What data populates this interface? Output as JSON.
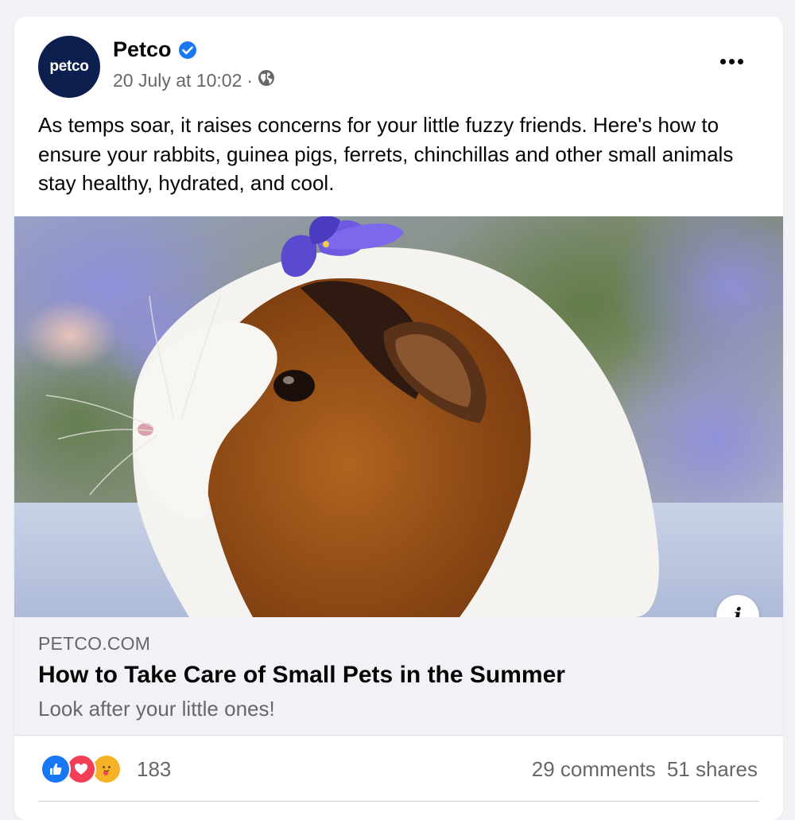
{
  "post": {
    "page_name": "Petco",
    "avatar_text": "petco",
    "timestamp": "20 July at 10:02",
    "separator": "·",
    "text": "As temps soar, it raises concerns for your little fuzzy friends. Here's how to ensure your rabbits, guinea pigs, ferrets, chinchillas and other small animals stay healthy, hydrated, and cool."
  },
  "icons": {
    "verified": "verified-badge-icon",
    "audience": "globe-icon",
    "more": "more-options-icon",
    "info": "info-icon",
    "info_glyph": "i"
  },
  "link": {
    "domain": "PETCO.COM",
    "title": "How to Take Care of Small Pets in the Summer",
    "description": "Look after your little ones!"
  },
  "stats": {
    "reaction_count": "183",
    "reactions": [
      "like",
      "love",
      "care"
    ],
    "comments": "29 comments",
    "shares": "51 shares"
  },
  "colors": {
    "brand": "#0c1f4e",
    "verified": "#1877f2",
    "like": "#1877f2",
    "love": "#f33e58",
    "care": "#f7b125"
  }
}
